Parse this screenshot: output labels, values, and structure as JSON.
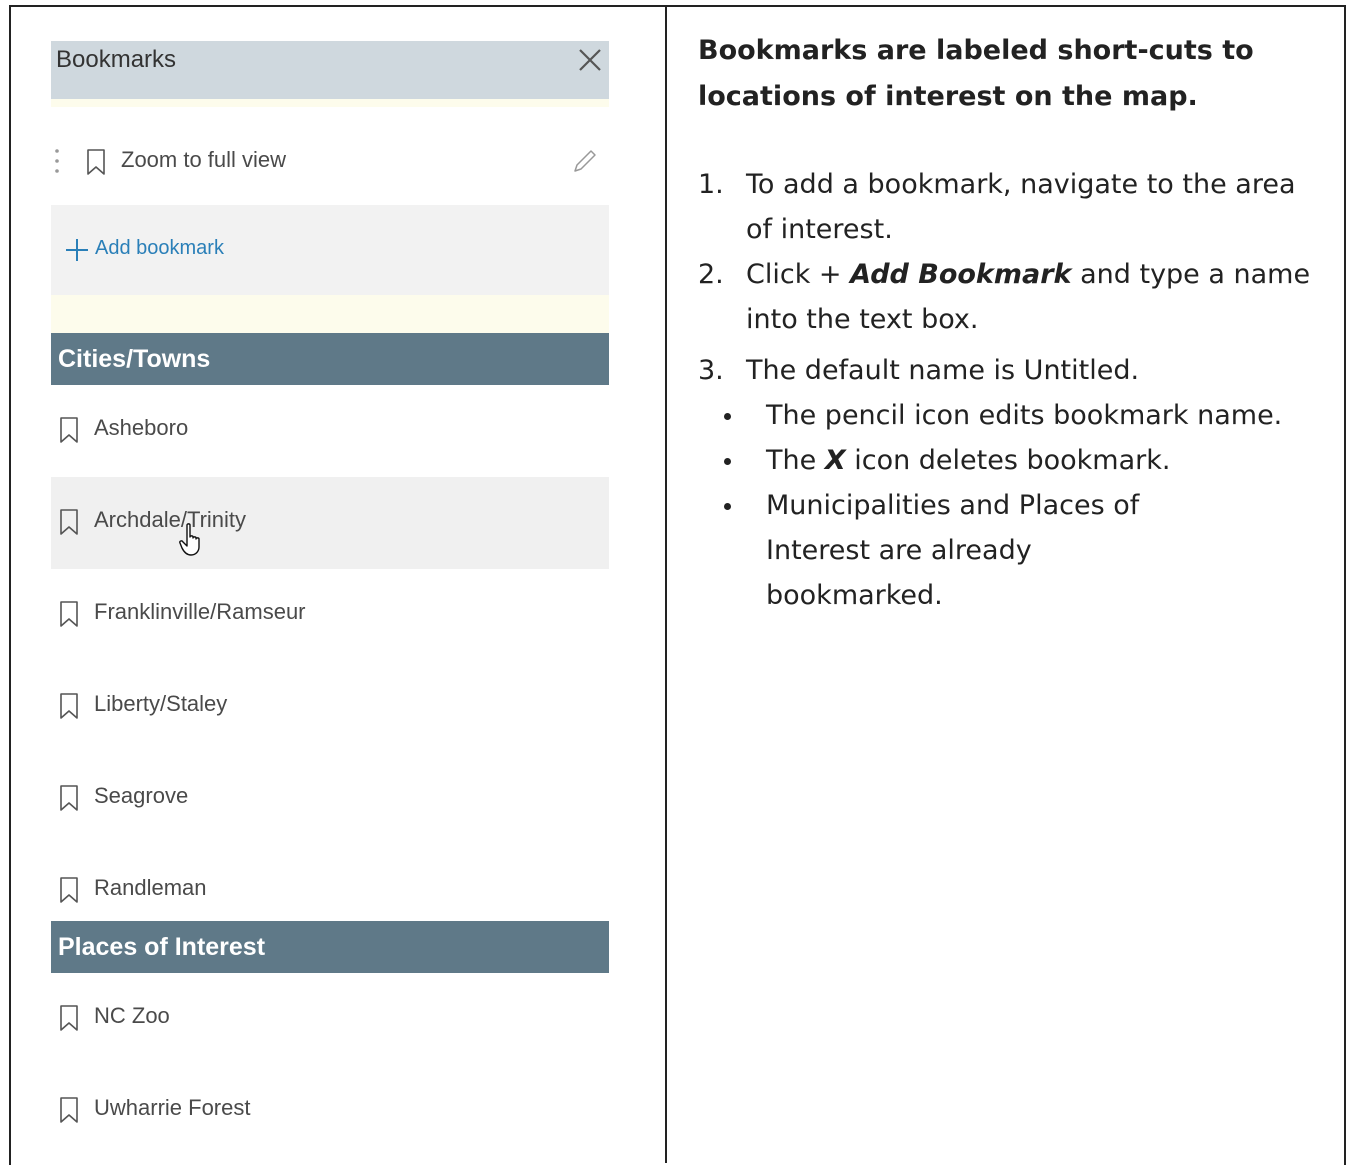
{
  "panel": {
    "title": "Bookmarks",
    "zoom_item": "Zoom to full view",
    "add_label": "Add bookmark",
    "sections": [
      {
        "title": "Cities/Towns",
        "items": [
          "Asheboro",
          "Archdale/Trinity",
          "Franklinville/Ramseur",
          "Liberty/Staley",
          "Seagrove",
          "Randleman"
        ]
      },
      {
        "title": "Places of Interest",
        "items": [
          "NC Zoo",
          "Uwharrie Forest"
        ]
      }
    ],
    "hovered_item": "Archdale/Trinity"
  },
  "instructions": {
    "heading": "Bookmarks are labeled short-cuts to locations of interest on the map.",
    "steps": [
      {
        "num": "1.",
        "text": "To add a bookmark, navigate to the area of interest."
      },
      {
        "num": "2.",
        "pre": "Click + ",
        "bold": "Add Bookmark",
        "post": " and type a name into the text box."
      },
      {
        "num": "3.",
        "text": "The default name is Untitled."
      }
    ],
    "bullets": [
      {
        "text": "The pencil icon edits bookmark name."
      },
      {
        "pre": "The ",
        "bold": "X",
        "post": " icon deletes bookmark."
      },
      {
        "text": "Municipalities and Places of Interest are already bookmarked."
      }
    ]
  },
  "colors": {
    "header_bg": "#cfd8de",
    "section_bg": "#5f7988",
    "add_link": "#2a7fb8",
    "cream": "#fdfcec"
  },
  "icons": [
    "close-icon",
    "drag-handle-icon",
    "bookmark-icon",
    "pencil-icon",
    "plus-icon",
    "hand-cursor-icon"
  ]
}
